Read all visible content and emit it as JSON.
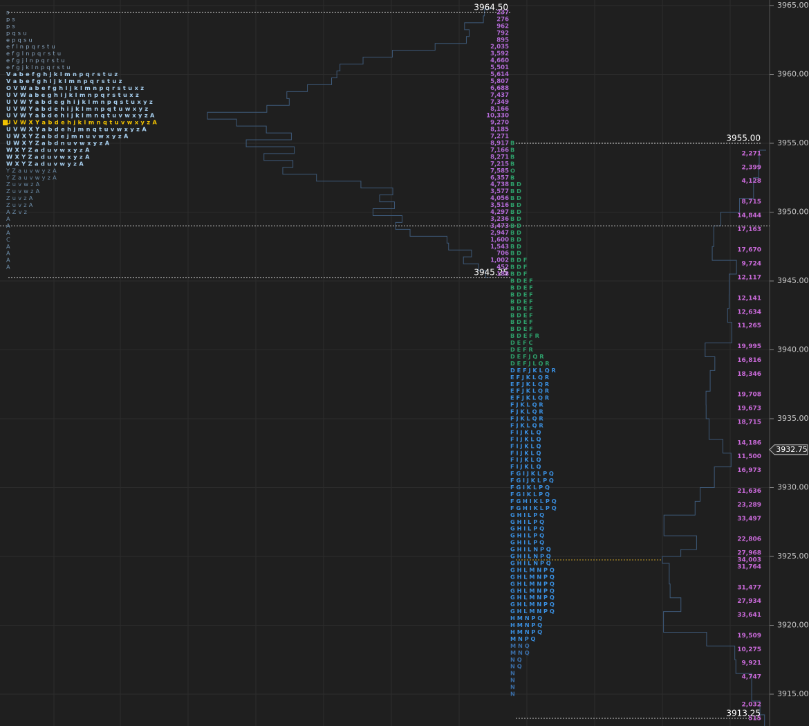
{
  "chart_data": {
    "type": "market-profile",
    "price_axis": {
      "ylim": [
        3912.4,
        3965.9
      ],
      "tick_step": 5,
      "tick_labels": [
        "3965.00",
        "3960.00",
        "3955.00",
        "3950.00",
        "3945.00",
        "3940.00",
        "3935.00",
        "3930.00",
        "3925.00",
        "3920.00",
        "3915.00"
      ],
      "current_price": "3932.75"
    },
    "annotations": [
      {
        "label": "3964.50",
        "price": 3964.5
      },
      {
        "label": "3945.25",
        "price": 3945.25
      },
      {
        "label": "3955.00",
        "price": 3955.0
      },
      {
        "label": "3913.25",
        "price": 3913.25
      }
    ],
    "profile_left": {
      "top_price": 3964.5,
      "poc_price": 3956.5,
      "rows": [
        "s",
        "p s",
        "p s",
        "p q s u",
        "e p q s u",
        "e f l n p q r s t u",
        "e f g l n p q r s t u",
        "e f g j l n p q r s t u",
        "e f g j k l n p q r s t u",
        "V a b e f g h j k l m n p q r s t u z",
        "V a b e f g h i j k l m n p q r s t u z",
        "O V W a b e f g h i j k l m n p q r s t u x z",
        "U V W a b e g h i j k l m n p q r s t u x z",
        "U V W Y a b d e g h i j k l m n p q s t u x y z",
        "U V W Y a b d e h i j k l m n p q t u w x y z",
        "U V W Y a b d e h i j k l m n q t u v w x y z A",
        "U V W X Y a b d e h j k l m n q t u v w x y z A",
        "U V W X Y a b d e h j m n q t u v w x y z A",
        "U W X Y Z a b d e j m n u v w x y z A",
        "U W X Y Z a b d n u v w x y z A",
        "W X Y Z a d u v w x y z A",
        "W X Y Z a d u v w x y z A",
        "W X Y Z a d u v w y z A",
        "Y Z a u v w y z A",
        "Y Z a u v w y z A",
        "Z u v w z A",
        "Z u v w z A",
        "Z u v z A",
        "Z u v z A",
        "A Z v z",
        "A",
        "A",
        "A",
        "C",
        "A",
        "A",
        "A",
        "A"
      ]
    },
    "volumes_left": [
      237,
      276,
      962,
      792,
      895,
      2035,
      3592,
      4660,
      5501,
      5614,
      5807,
      6688,
      7437,
      7349,
      8166,
      10330,
      9270,
      8185,
      7271,
      8917,
      7166,
      8271,
      7215,
      7585,
      6357,
      4738,
      3577,
      4056,
      3516,
      4297,
      3236,
      3473,
      2947,
      1600,
      1543,
      706,
      1002,
      452,
      188
    ],
    "profile_right": {
      "top_price": 3955.0,
      "poc_price": 3937.25,
      "rows": [
        "B",
        "B",
        "B",
        "B",
        "O",
        "B",
        "B D",
        "B D",
        "B D",
        "B D",
        "B D",
        "B D",
        "B D",
        "B D",
        "B D",
        "B D",
        "B D",
        "B D F",
        "B D F",
        "B D F",
        "B D E F",
        "B D E F",
        "B D E F",
        "B D E F",
        "B D E F",
        "B D E F",
        "B D E F",
        "B D E F",
        "B D E F R",
        "D E F C",
        "D E F R",
        "D E F J Q R",
        "D E F J L Q R",
        "D E F J K L Q R",
        "E F J K L Q R",
        "E F J K L Q R",
        "E F J K L Q R",
        "E F J K L Q R",
        "F J K L Q R",
        "F J K L Q R",
        "F J K L Q R",
        "F J K L Q R",
        "F I J K L Q",
        "F I J K L Q",
        "F I J K L Q",
        "F I J K L Q",
        "F I J K L Q",
        "F I J K L Q",
        "F G I J K L P Q",
        "F G I J K L P Q",
        "F G I K L P Q",
        "F G I K L P Q",
        "F G H I K L P Q",
        "F G H I K L P Q",
        "G H I L P Q",
        "G H I L P Q",
        "G H I L P Q",
        "G H I L P Q",
        "G H I L P Q",
        "G H I L N P Q",
        "G H I L N P Q",
        "G H I L N P Q",
        "G H L M N P Q",
        "G H L M N P Q",
        "G H L M N P Q",
        "G H L M N P Q",
        "G H L M N P Q",
        "G H L M N P Q",
        "G H L M N P Q",
        "H M N P Q",
        "H M N P Q",
        "H M N P Q",
        "M N P Q",
        "M N Q",
        "M N Q",
        "N Q",
        "N Q",
        "N",
        "N",
        "N",
        "N"
      ],
      "letter_colors": [
        "#2e9e6a",
        "#2e9e6a",
        "#2e9e6a",
        "#2e9e6a",
        "#2e9e6a",
        "#2e9e6a",
        "#2e9e6a",
        "#2e9e6a",
        "#2e9e6a",
        "#2e9e6a",
        "#2e9e6a",
        "#2e9e6a",
        "#2e9e6a",
        "#2e9e6a",
        "#2e9e6a",
        "#2e9e6a",
        "#2e9e6a",
        "#2e9e6a",
        "#2e9e6a",
        "#2e9e6a",
        "#2e9e6a",
        "#2e9e6a",
        "#2e9e6a",
        "#2e9e6a",
        "#2e9e6a",
        "#2e9e6a",
        "#2e9e6a",
        "#2e9e6a",
        "#2e9e6a",
        "#2e9e6a",
        "#2e9e6a",
        "#2e9e6a",
        "#2e9e6a",
        "#3a8fe0",
        "#3a8fe0",
        "#3a8fe0",
        "#3a8fe0",
        "#3a8fe0",
        "#3a8fe0",
        "#3a8fe0",
        "#3a8fe0",
        "#3a8fe0",
        "#3a8fe0",
        "#3a8fe0",
        "#3a8fe0",
        "#3a8fe0",
        "#3a8fe0",
        "#3a8fe0",
        "#3a8fe0",
        "#3a8fe0",
        "#3a8fe0",
        "#3a8fe0",
        "#3a8fe0",
        "#3a8fe0",
        "#3a8fe0",
        "#3a8fe0",
        "#3a8fe0",
        "#3a8fe0",
        "#3a8fe0",
        "#3a8fe0",
        "#3a8fe0",
        "#3a8fe0",
        "#3a8fe0",
        "#3a8fe0",
        "#3a8fe0",
        "#3a8fe0",
        "#3a8fe0",
        "#3a8fe0",
        "#3a8fe0",
        "#3a8fe0",
        "#3a8fe0",
        "#3a8fe0",
        "#3a8fe0",
        "#3a6ea8",
        "#3a6ea8",
        "#3a6ea8",
        "#3a6ea8",
        "#3a6ea8",
        "#3a6ea8",
        "#3a6ea8",
        "#3a6ea8"
      ]
    },
    "volumes_right": [
      {
        "price": 3954.25,
        "value": "2,271"
      },
      {
        "price": 3953.25,
        "value": "2,399"
      },
      {
        "price": 3952.25,
        "value": "4,128"
      },
      {
        "price": 3950.75,
        "value": "8,715"
      },
      {
        "price": 3949.75,
        "value": "14,844"
      },
      {
        "price": 3948.75,
        "value": "17,163"
      },
      {
        "price": 3947.25,
        "value": "17,670"
      },
      {
        "price": 3946.25,
        "value": "9,724"
      },
      {
        "price": 3945.25,
        "value": "12,117"
      },
      {
        "price": 3943.75,
        "value": "12,141"
      },
      {
        "price": 3942.75,
        "value": "12,634"
      },
      {
        "price": 3941.75,
        "value": "11,265"
      },
      {
        "price": 3940.25,
        "value": "19,995"
      },
      {
        "price": 3939.25,
        "value": "16,816"
      },
      {
        "price": 3938.25,
        "value": "18,346"
      },
      {
        "price": 3936.75,
        "value": "19,708"
      },
      {
        "price": 3935.75,
        "value": "19,673"
      },
      {
        "price": 3934.75,
        "value": "18,715"
      },
      {
        "price": 3933.25,
        "value": "14,186"
      },
      {
        "price": 3932.25,
        "value": "11,500"
      },
      {
        "price": 3931.25,
        "value": "16,973"
      },
      {
        "price": 3929.75,
        "value": "21,636"
      },
      {
        "price": 3928.75,
        "value": "23,289"
      },
      {
        "price": 3927.75,
        "value": "33,497"
      },
      {
        "price": 3926.25,
        "value": "22,806"
      },
      {
        "price": 3925.25,
        "value": "27,968"
      },
      {
        "price": 3924.75,
        "value": "34,003"
      },
      {
        "price": 3924.25,
        "value": "31,764"
      },
      {
        "price": 3922.75,
        "value": "31,477"
      },
      {
        "price": 3921.75,
        "value": "27,934"
      },
      {
        "price": 3920.75,
        "value": "33,641"
      },
      {
        "price": 3919.25,
        "value": "19,509"
      },
      {
        "price": 3918.25,
        "value": "10,275"
      },
      {
        "price": 3917.25,
        "value": "9,921"
      },
      {
        "price": 3916.25,
        "value": "4,747"
      },
      {
        "price": 3914.25,
        "value": "2,032"
      },
      {
        "price": 3913.25,
        "value": "515"
      }
    ]
  }
}
